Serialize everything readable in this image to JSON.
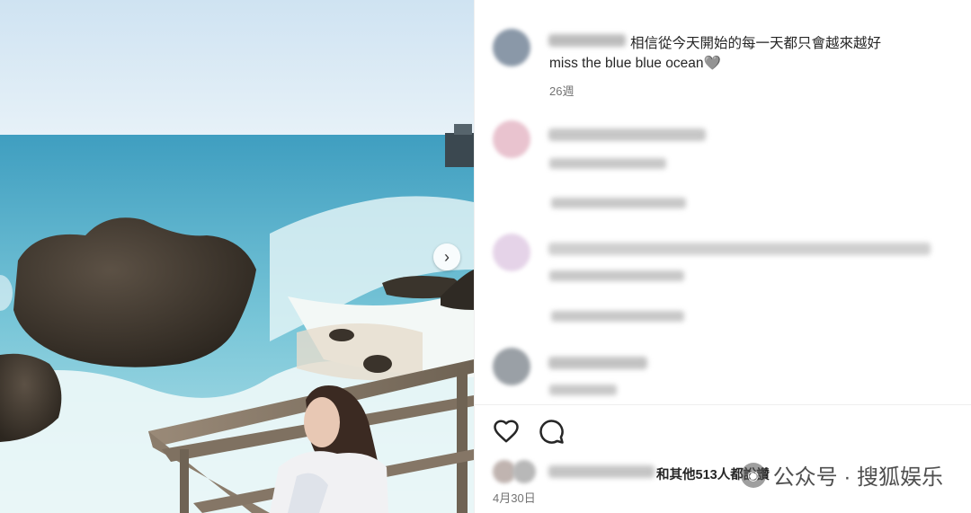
{
  "post": {
    "caption_line1": "相信從今天開始的每一天都只會越來越好",
    "caption_line2": "miss the blue blue ocean🩶",
    "caption_time": "26週"
  },
  "photo": {
    "next_icon": "chevron-right-icon"
  },
  "actions": {
    "like_icon": "heart-icon",
    "comment_icon": "comment-icon"
  },
  "likes": {
    "text": "和其他513人都說讚"
  },
  "date": "4月30日",
  "watermark": {
    "logo_icon": "wechat-icon",
    "text": "公众号 · 搜狐娱乐"
  }
}
